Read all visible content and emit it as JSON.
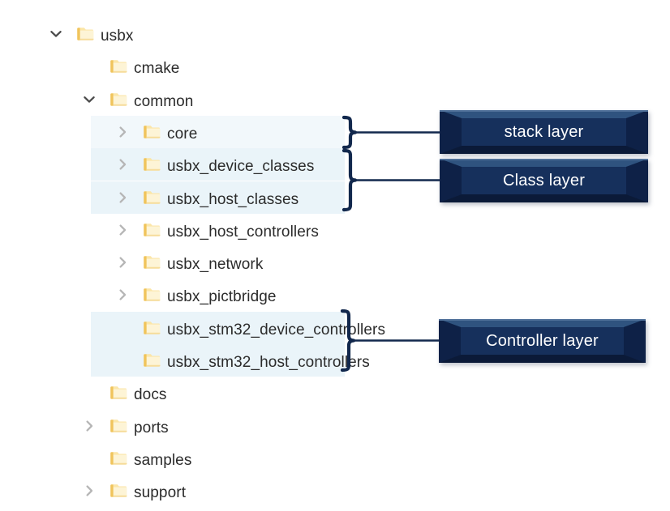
{
  "diagram": {
    "title_text": "",
    "colors": {
      "box_fill": "#16305c",
      "box_fill_light": "#2d517f",
      "box_fill_dark": "#0d1f3e",
      "brace_stroke": "#12284d",
      "connector_stroke": "#12284d",
      "row_highlight": "#f2f8fb",
      "row_highlight_deep": "#eaf4f9",
      "folder_fill": "#ffd87a",
      "folder_fill_light": "#fdf1c9",
      "label_text": "#2b2b2b",
      "chevron_collapsed": "#b6b6b6",
      "chevron_expanded": "#4b4b4b",
      "box_text": "#ffffff",
      "page_background": "#ffffff"
    },
    "tree": {
      "root_name": "usbx",
      "nodes": [
        {
          "label": "usbx",
          "depth": 0,
          "twisty": "chevron-down-icon",
          "state": "expanded",
          "highlight": "none",
          "icon": "folder-icon"
        },
        {
          "label": "cmake",
          "depth": 1,
          "twisty": "none",
          "state": "leaf",
          "highlight": "none",
          "icon": "folder-icon"
        },
        {
          "label": "common",
          "depth": 1,
          "twisty": "chevron-down-icon",
          "state": "expanded",
          "highlight": "none",
          "icon": "folder-icon"
        },
        {
          "label": "core",
          "depth": 2,
          "twisty": "chevron-right-icon",
          "state": "collapsed",
          "highlight": "light",
          "icon": "folder-icon"
        },
        {
          "label": "usbx_device_classes",
          "depth": 2,
          "twisty": "chevron-right-icon",
          "state": "collapsed",
          "highlight": "deep",
          "icon": "folder-icon"
        },
        {
          "label": "usbx_host_classes",
          "depth": 2,
          "twisty": "chevron-right-icon",
          "state": "collapsed",
          "highlight": "deep",
          "icon": "folder-icon"
        },
        {
          "label": "usbx_host_controllers",
          "depth": 2,
          "twisty": "chevron-right-icon",
          "state": "collapsed",
          "highlight": "none",
          "icon": "folder-icon"
        },
        {
          "label": "usbx_network",
          "depth": 2,
          "twisty": "chevron-right-icon",
          "state": "collapsed",
          "highlight": "none",
          "icon": "folder-icon"
        },
        {
          "label": "usbx_pictbridge",
          "depth": 2,
          "twisty": "chevron-right-icon",
          "state": "collapsed",
          "highlight": "none",
          "icon": "folder-icon"
        },
        {
          "label": "usbx_stm32_device_controllers",
          "depth": 2,
          "twisty": "none",
          "state": "leaf",
          "highlight": "deep",
          "icon": "folder-icon"
        },
        {
          "label": "usbx_stm32_host_controllers",
          "depth": 2,
          "twisty": "none",
          "state": "leaf",
          "highlight": "deep",
          "icon": "folder-icon"
        },
        {
          "label": "docs",
          "depth": 1,
          "twisty": "none",
          "state": "leaf",
          "highlight": "none",
          "icon": "folder-icon"
        },
        {
          "label": "ports",
          "depth": 1,
          "twisty": "chevron-right-icon",
          "state": "collapsed",
          "highlight": "none",
          "icon": "folder-icon"
        },
        {
          "label": "samples",
          "depth": 1,
          "twisty": "none",
          "state": "leaf",
          "highlight": "none",
          "icon": "folder-icon"
        },
        {
          "label": "support",
          "depth": 1,
          "twisty": "chevron-right-icon",
          "state": "collapsed",
          "highlight": "none",
          "icon": "folder-icon"
        }
      ]
    },
    "callouts": [
      {
        "id": "stack-layer",
        "label": "stack layer",
        "groups": [
          "core"
        ],
        "brace": "right-curly-brace"
      },
      {
        "id": "class-layer",
        "label": "Class layer",
        "groups": [
          "usbx_device_classes",
          "usbx_host_classes"
        ],
        "brace": "right-curly-brace"
      },
      {
        "id": "controller-layer",
        "label": "Controller layer",
        "groups": [
          "usbx_stm32_device_controllers",
          "usbx_stm32_host_controllers"
        ],
        "brace": "right-curly-brace"
      }
    ]
  }
}
